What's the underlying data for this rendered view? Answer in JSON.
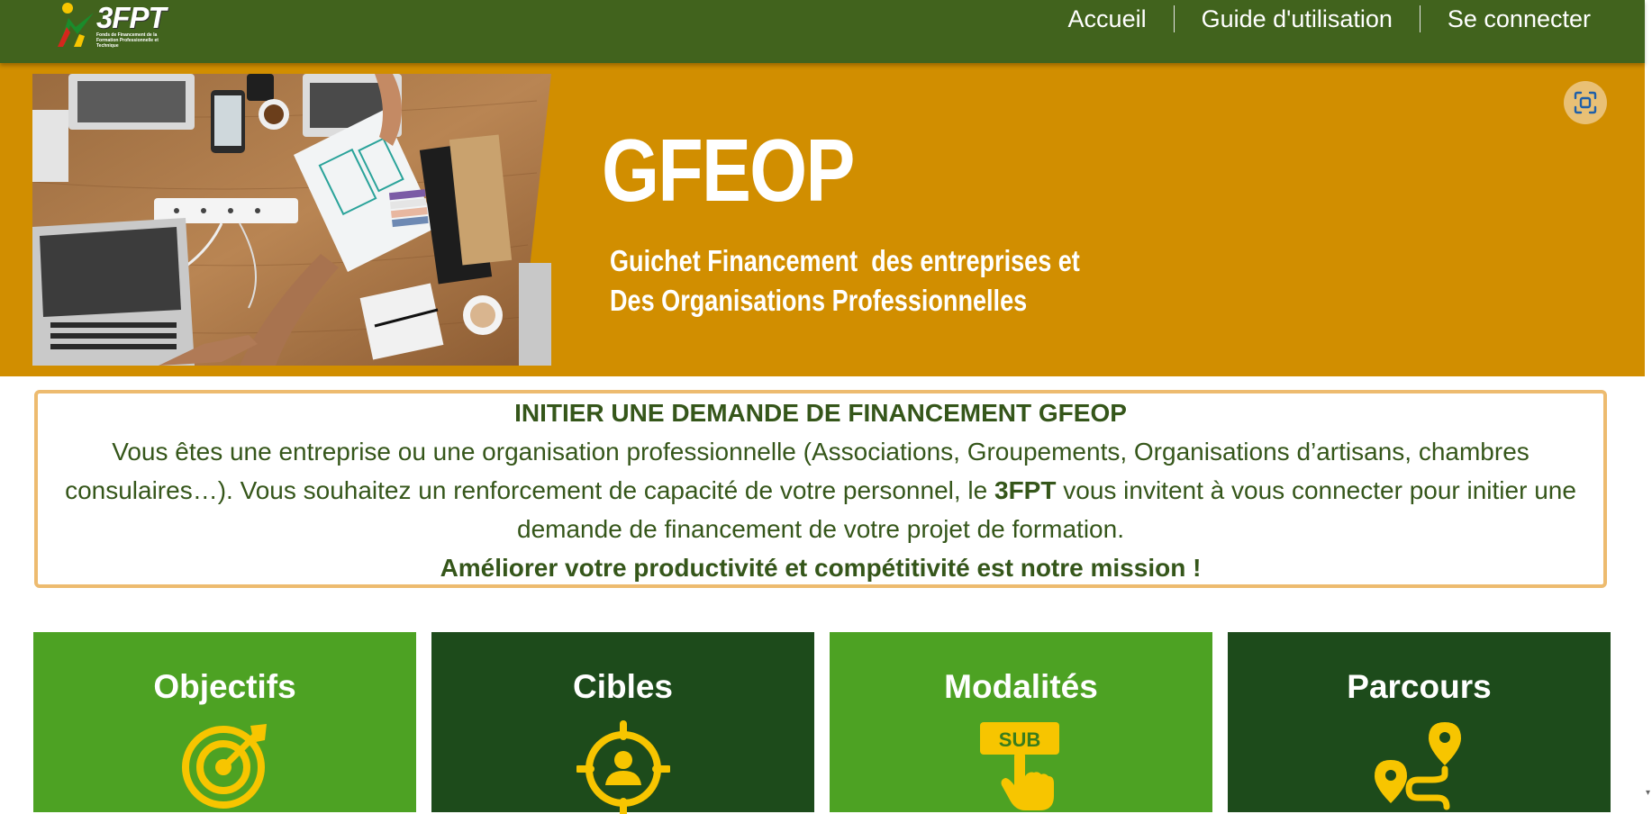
{
  "header": {
    "logo_text": "3FPT",
    "logo_tagline": "Fonds de Financement de la Formation Professionnelle et Technique",
    "nav": [
      {
        "label": "Accueil"
      },
      {
        "label": "Guide d'utilisation"
      },
      {
        "label": "Se connecter"
      }
    ]
  },
  "banner": {
    "title": "GFEOP",
    "subtitle_line1": "Guichet Financement  des entreprises et",
    "subtitle_line2": "Des Organisations Professionnelles",
    "scan_icon": "screenshot-scan-icon"
  },
  "intro": {
    "title": "INITIER UNE DEMANDE DE FINANCEMENT GFEOP",
    "text_part1": "Vous êtes une entreprise ou une organisation professionnelle (Associations, Groupements, Organisations d’artisans, chambres consulaires…). Vous souhaitez un renforcement de capacité de votre personnel, le ",
    "brand": "3FPT",
    "text_part2": " vous invitent à vous connecter pour initier une demande de financement de votre projet de formation.",
    "mission": "Améliorer votre productivité et compétitivité est notre mission !"
  },
  "cards": [
    {
      "title": "Objectifs",
      "icon": "target-icon"
    },
    {
      "title": "Cibles",
      "icon": "person-crosshair-icon"
    },
    {
      "title": "Modalités",
      "icon": "sub-click-icon",
      "icon_text": "SUB"
    },
    {
      "title": "Parcours",
      "icon": "route-pins-icon"
    }
  ],
  "colors": {
    "navbar": "#41631d",
    "banner": "#d18e00",
    "card_light": "#4da223",
    "card_dark": "#1d4b1b",
    "icon_yellow": "#f7c500",
    "intro_border": "#edbb6f",
    "intro_text": "#35561a"
  }
}
